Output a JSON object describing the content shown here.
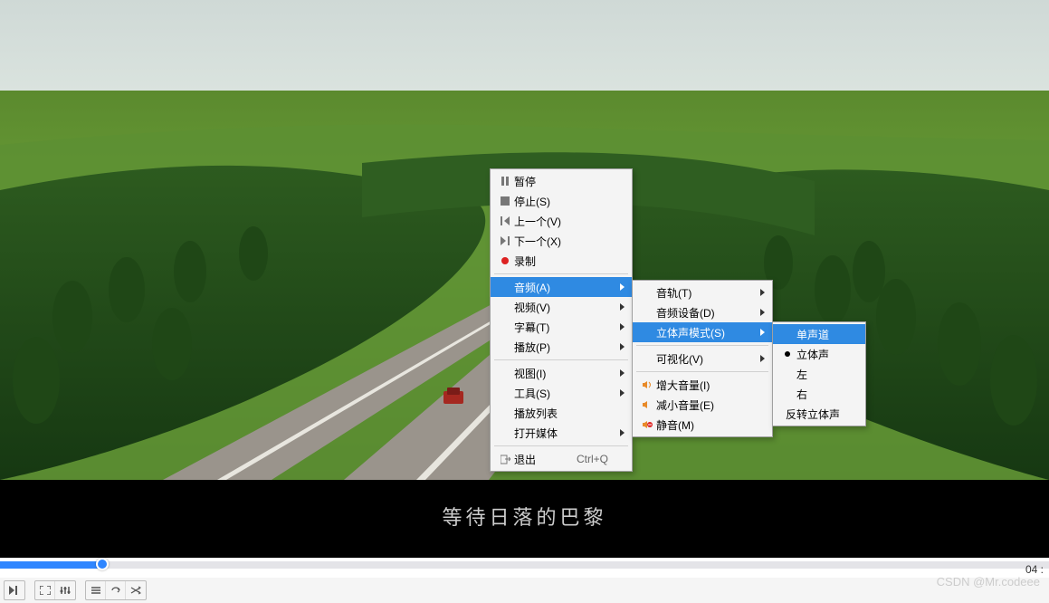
{
  "subtitle": "等待日落的巴黎",
  "time_right": "04 :",
  "watermark": "CSDN @Mr.codeee",
  "menu1": {
    "pause": "暂停",
    "stop": "停止(S)",
    "prev": "上一个(V)",
    "next": "下一个(X)",
    "record": "录制",
    "audio": "音频(A)",
    "video": "视频(V)",
    "subtitle": "字幕(T)",
    "playback": "播放(P)",
    "view": "视图(I)",
    "tools": "工具(S)",
    "playlist": "播放列表",
    "open": "打开媒体",
    "quit": "退出",
    "quit_shortcut": "Ctrl+Q"
  },
  "menu2": {
    "track": "音轨(T)",
    "device": "音频设备(D)",
    "stereo": "立体声模式(S)",
    "visual": "可视化(V)",
    "volup": "增大音量(I)",
    "voldown": "减小音量(E)",
    "mute": "静音(M)"
  },
  "menu3": {
    "mono": "单声道",
    "stereo": "立体声",
    "left": "左",
    "right": "右",
    "reverse": "反转立体声"
  }
}
